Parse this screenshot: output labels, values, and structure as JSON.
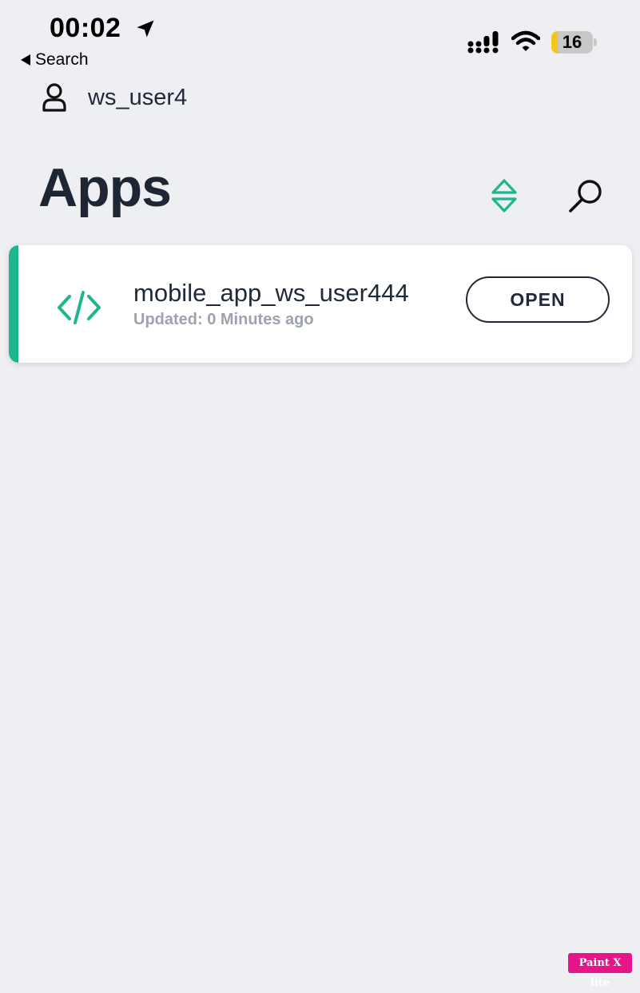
{
  "status_bar": {
    "time": "00:02",
    "back_label": "Search",
    "battery_level": "16",
    "battery_fill_fraction": 0.16,
    "icons": [
      "location-arrow-icon",
      "cellular-signal-icon",
      "wifi-icon",
      "battery-icon"
    ]
  },
  "header": {
    "username": "ws_user4",
    "title": "Apps",
    "icons": [
      "user-icon",
      "sort-icon",
      "search-icon"
    ]
  },
  "apps": [
    {
      "name": "mobile_app_ws_user444",
      "updated": "Updated: 0 Minutes ago",
      "action_label": "OPEN",
      "icon": "code-icon"
    }
  ],
  "watermark": "Paint X lite",
  "colors": {
    "accent": "#1fb58f",
    "background": "#eeeff3",
    "text": "#1f2937",
    "muted": "#9ca3af",
    "battery": "#f5c518"
  }
}
